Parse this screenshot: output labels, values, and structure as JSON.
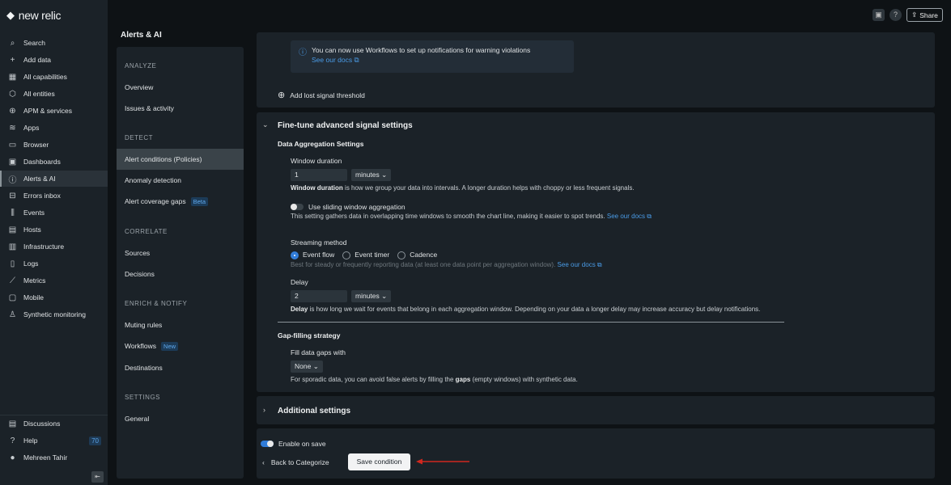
{
  "brand": "new relic",
  "nav": {
    "items": [
      {
        "label": "Search",
        "icon": "search-icon",
        "g": "⌕"
      },
      {
        "label": "Add data",
        "icon": "plus-icon",
        "g": "+"
      },
      {
        "label": "All capabilities",
        "icon": "grid-icon",
        "g": "▦"
      },
      {
        "label": "All entities",
        "icon": "entities-icon",
        "g": "⬡"
      },
      {
        "label": "APM & services",
        "icon": "globe-icon",
        "g": "⊕"
      },
      {
        "label": "Apps",
        "icon": "layers-icon",
        "g": "≋"
      },
      {
        "label": "Browser",
        "icon": "browser-icon",
        "g": "▭"
      },
      {
        "label": "Dashboards",
        "icon": "dashboard-icon",
        "g": "▣"
      },
      {
        "label": "Alerts & AI",
        "icon": "alert-icon",
        "g": "ⓘ",
        "active": true
      },
      {
        "label": "Errors inbox",
        "icon": "inbox-icon",
        "g": "⊟"
      },
      {
        "label": "Events",
        "icon": "events-icon",
        "g": "⫼"
      },
      {
        "label": "Hosts",
        "icon": "hosts-icon",
        "g": "▤"
      },
      {
        "label": "Infrastructure",
        "icon": "infrastructure-icon",
        "g": "▥"
      },
      {
        "label": "Logs",
        "icon": "logs-icon",
        "g": "▯"
      },
      {
        "label": "Metrics",
        "icon": "metrics-icon",
        "g": "⟋"
      },
      {
        "label": "Mobile",
        "icon": "mobile-icon",
        "g": "▢"
      },
      {
        "label": "Synthetic monitoring",
        "icon": "synthetic-icon",
        "g": "♙"
      }
    ],
    "bottom": [
      {
        "label": "Discussions",
        "icon": "discussions-icon",
        "g": "▤"
      },
      {
        "label": "Help",
        "icon": "help-icon",
        "g": "?",
        "badge": "70"
      },
      {
        "label": "Mehreen Tahir",
        "icon": "avatar",
        "g": "●"
      }
    ]
  },
  "header": {
    "title": "Alerts & AI",
    "share": "Share"
  },
  "subnav": {
    "sections": [
      "ANALYZE",
      "DETECT",
      "CORRELATE",
      "ENRICH & NOTIFY",
      "SETTINGS"
    ],
    "items": [
      "Overview",
      "Issues & activity",
      "Alert conditions (Policies)",
      "Anomaly detection",
      "Alert coverage gaps",
      "Sources",
      "Decisions",
      "Muting rules",
      "Workflows",
      "Destinations",
      "General"
    ],
    "beta": "Beta",
    "new": "New"
  },
  "info": {
    "text": "You can now use Workflows to set up notifications for warning violations",
    "link": "See our docs"
  },
  "add_lost_signal": "Add lost signal threshold",
  "finetune": {
    "title": "Fine-tune advanced signal settings",
    "agg_title": "Data Aggregation Settings",
    "window_label": "Window duration",
    "window_value": "1",
    "window_unit": "minutes",
    "window_help_b": "Window duration",
    "window_help": " is how we group your data into intervals. A longer duration helps with choppy or less frequent signals.",
    "sliding_label": "Use sliding window aggregation",
    "sliding_on": false,
    "sliding_help": "This setting gathers data in overlapping time windows to smooth the chart line, making it easier to spot trends.",
    "docs": "See our docs",
    "stream_label": "Streaming method",
    "stream_options": [
      "Event flow",
      "Event timer",
      "Cadence"
    ],
    "stream_selected": "Event flow",
    "stream_help": "Best for steady or frequently reporting data (at least one data point per aggregation window).",
    "delay_label": "Delay",
    "delay_value": "2",
    "delay_unit": "minutes",
    "delay_help_b": "Delay",
    "delay_help": " is how long we wait for events that belong in each aggregation window. Depending on your data a longer delay may increase accuracy but delay notifications.",
    "gap_title": "Gap-filling strategy",
    "gap_label": "Fill data gaps with",
    "gap_value": "None",
    "gap_help_1": "For sporadic data, you can avoid false alerts by filling the ",
    "gap_help_b": "gaps",
    "gap_help_2": " (empty windows) with synthetic data."
  },
  "additional": "Additional settings",
  "footer": {
    "enable": "Enable on save",
    "enable_on": true,
    "back": "Back to Categorize",
    "save": "Save condition",
    "arrow_color": "#d0281f"
  }
}
